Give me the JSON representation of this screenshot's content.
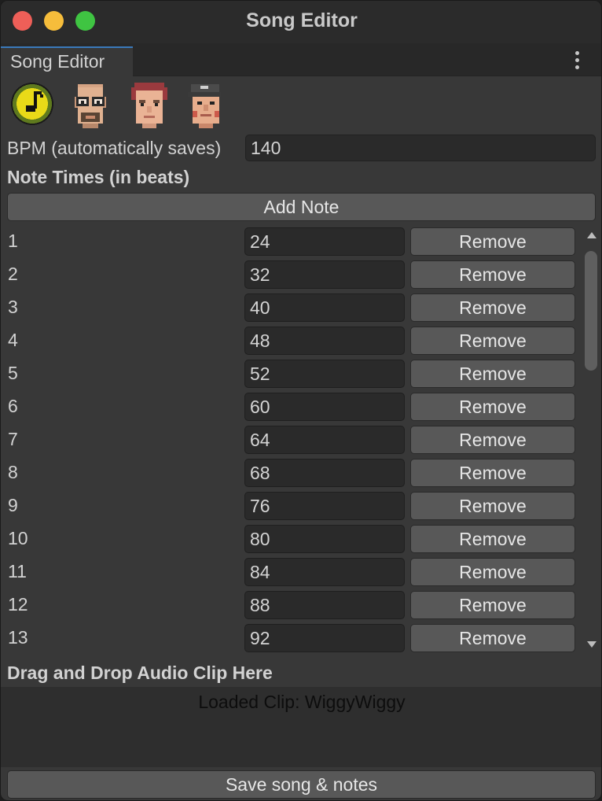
{
  "window": {
    "title": "Song Editor",
    "tab_label": "Song Editor",
    "controls": [
      "close-icon",
      "minimize-icon",
      "maximize-icon"
    ]
  },
  "toolbar": {
    "characters": [
      {
        "name": "music-note-icon"
      },
      {
        "name": "bald-glasses-avatar"
      },
      {
        "name": "red-hair-avatar"
      },
      {
        "name": "cap-avatar"
      }
    ]
  },
  "bpm": {
    "label": "BPM (automatically saves)",
    "value": "140"
  },
  "notes": {
    "heading": "Note Times (in beats)",
    "add_label": "Add Note",
    "remove_label": "Remove",
    "rows": [
      {
        "index": "1",
        "value": "24"
      },
      {
        "index": "2",
        "value": "32"
      },
      {
        "index": "3",
        "value": "40"
      },
      {
        "index": "4",
        "value": "48"
      },
      {
        "index": "5",
        "value": "52"
      },
      {
        "index": "6",
        "value": "60"
      },
      {
        "index": "7",
        "value": "64"
      },
      {
        "index": "8",
        "value": "68"
      },
      {
        "index": "9",
        "value": "76"
      },
      {
        "index": "10",
        "value": "80"
      },
      {
        "index": "11",
        "value": "84"
      },
      {
        "index": "12",
        "value": "88"
      },
      {
        "index": "13",
        "value": "92"
      }
    ]
  },
  "audio": {
    "drop_label": "Drag and Drop Audio Clip Here",
    "loaded_text": "Loaded Clip: WiggyWiggy"
  },
  "footer": {
    "save_label": "Save song & notes"
  },
  "colors": {
    "accent": "#3a79bb",
    "panel": "#383838",
    "field": "#2a2a2a",
    "button": "#585858"
  }
}
